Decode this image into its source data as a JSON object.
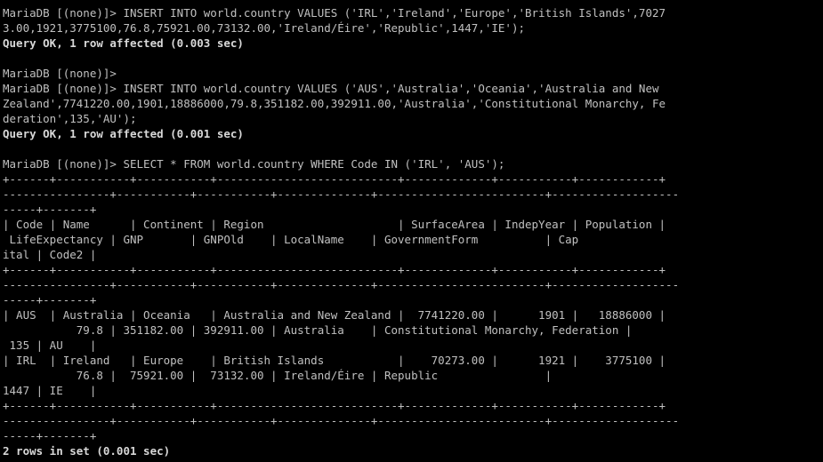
{
  "terminal": {
    "lines": [
      {
        "text": "MariaDB [(none)]> INSERT INTO world.country VALUES ('IRL','Ireland','Europe','British Islands',7027",
        "bold": false
      },
      {
        "text": "3.00,1921,3775100,76.8,75921.00,73132.00,'Ireland/Éire','Republic',1447,'IE');",
        "bold": false
      },
      {
        "text": "Query OK, 1 row affected (0.003 sec)",
        "bold": true
      },
      {
        "text": "",
        "bold": false
      },
      {
        "text": "MariaDB [(none)]>",
        "bold": false
      },
      {
        "text": "MariaDB [(none)]> INSERT INTO world.country VALUES ('AUS','Australia','Oceania','Australia and New",
        "bold": false
      },
      {
        "text": "Zealand',7741220.00,1901,18886000,79.8,351182.00,392911.00,'Australia','Constitutional Monarchy, Fe",
        "bold": false
      },
      {
        "text": "deration',135,'AU');",
        "bold": false
      },
      {
        "text": "Query OK, 1 row affected (0.001 sec)",
        "bold": true
      },
      {
        "text": "",
        "bold": false
      },
      {
        "text": "MariaDB [(none)]> SELECT * FROM world.country WHERE Code IN ('IRL', 'AUS');",
        "bold": false
      },
      {
        "text": "+------+-----------+-----------+---------------------------+-------------+-----------+------------+",
        "bold": false
      },
      {
        "text": "----------------+-----------+-----------+--------------+-------------------------+-------------------",
        "bold": false
      },
      {
        "text": "-----+-------+",
        "bold": false
      },
      {
        "text": "| Code | Name      | Continent | Region                    | SurfaceArea | IndepYear | Population |",
        "bold": false
      },
      {
        "text": " LifeExpectancy | GNP       | GNPOld    | LocalName    | GovernmentForm          | Cap",
        "bold": false
      },
      {
        "text": "ital | Code2 |",
        "bold": false
      },
      {
        "text": "+------+-----------+-----------+---------------------------+-------------+-----------+------------+",
        "bold": false
      },
      {
        "text": "----------------+-----------+-----------+--------------+-------------------------+-------------------",
        "bold": false
      },
      {
        "text": "-----+-------+",
        "bold": false
      },
      {
        "text": "| AUS  | Australia | Oceania   | Australia and New Zealand |  7741220.00 |      1901 |   18886000 |",
        "bold": false
      },
      {
        "text": "           79.8 | 351182.00 | 392911.00 | Australia    | Constitutional Monarchy, Federation |",
        "bold": false
      },
      {
        "text": " 135 | AU    |",
        "bold": false
      },
      {
        "text": "| IRL  | Ireland   | Europe    | British Islands           |    70273.00 |      1921 |    3775100 |",
        "bold": false
      },
      {
        "text": "           76.8 |  75921.00 |  73132.00 | Ireland/Éire | Republic                |",
        "bold": false
      },
      {
        "text": "1447 | IE    |",
        "bold": false
      },
      {
        "text": "+------+-----------+-----------+---------------------------+-------------+-----------+------------+",
        "bold": false
      },
      {
        "text": "----------------+-----------+-----------+--------------+-------------------------+-------------------",
        "bold": false
      },
      {
        "text": "-----+-------+",
        "bold": false
      },
      {
        "text": "2 rows in set (0.001 sec)",
        "bold": true
      }
    ]
  },
  "colors": {
    "background": "#000000",
    "text": "#c0c0c0",
    "bold_text": "#d8d8d8"
  }
}
